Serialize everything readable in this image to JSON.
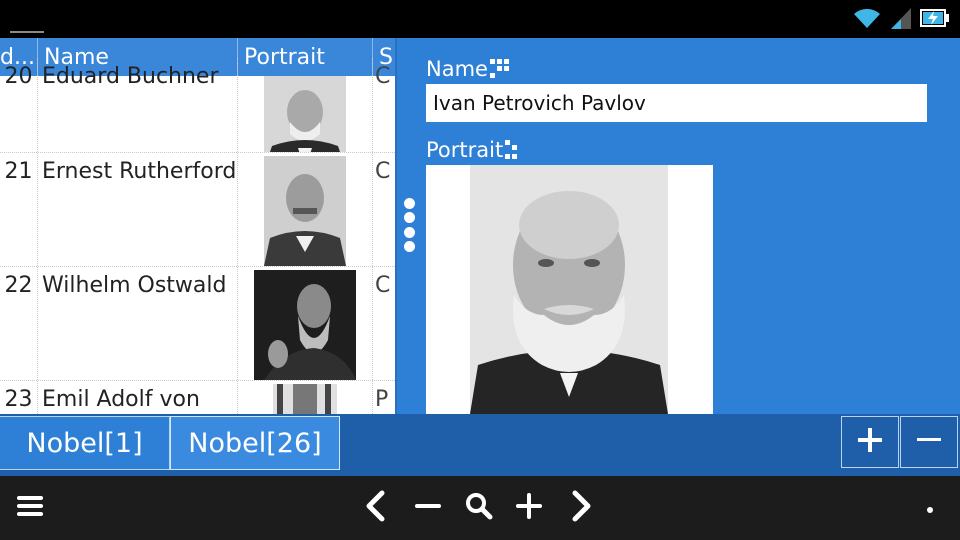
{
  "table": {
    "columns": [
      "d...",
      "Name",
      "Portrait",
      "S"
    ],
    "rows": [
      {
        "id": "20",
        "name": "Eduard Buchner",
        "s": "C"
      },
      {
        "id": "21",
        "name": "Ernest Rutherford",
        "s": "C"
      },
      {
        "id": "22",
        "name": "Wilhelm Ostwald",
        "s": "C"
      },
      {
        "id": "23",
        "name": "Emil Adolf von",
        "s": "P"
      }
    ]
  },
  "detail": {
    "name_label": "Name",
    "name_value": "Ivan Petrovich Pavlov",
    "portrait_label": "Portrait"
  },
  "tabs": {
    "items": [
      {
        "label": "Nobel[1]"
      },
      {
        "label": "Nobel[26]"
      }
    ],
    "add_label": "+",
    "remove_label": "−"
  },
  "toolbar": {
    "icons": [
      "menu-icon",
      "chevron-left-icon",
      "minus-icon",
      "search-icon",
      "plus-icon",
      "chevron-right-icon",
      "overflow-dot-icon"
    ]
  },
  "status": {
    "icons": [
      "wifi-icon",
      "signal-icon",
      "battery-charging-icon"
    ]
  },
  "colors": {
    "accent": "#2e7fd6",
    "header": "#3a87da",
    "tab_bar": "#1f5fa9"
  }
}
